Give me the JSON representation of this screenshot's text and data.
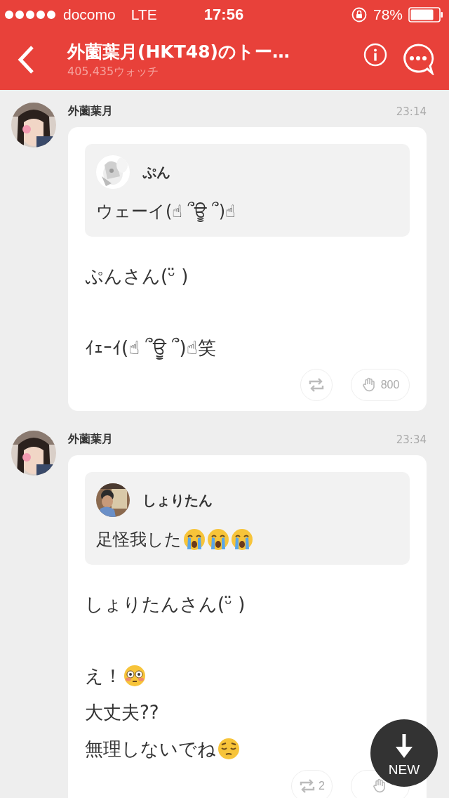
{
  "status_bar": {
    "carrier": "docomo",
    "network": "LTE",
    "time": "17:56",
    "battery": "78%"
  },
  "header": {
    "title": "外薗葉月(HKT48)のトー…",
    "subtitle": "405,435ウォッチ"
  },
  "messages": [
    {
      "author": "外薗葉月",
      "time": "23:14",
      "quote": {
        "author": "ぷん",
        "lines": [
          [
            {
              "kind": "text",
              "text": "ウェーイ(☝ ՞ਊ ՞)☝"
            }
          ]
        ]
      },
      "lines": [
        {
          "kind": "text",
          "parts": [
            {
              "kind": "text",
              "text": "ぷんさん(ᵕ̈ )"
            }
          ]
        },
        {
          "kind": "gap"
        },
        {
          "kind": "text",
          "parts": [
            {
              "kind": "text",
              "text": "ｲｪｰｲ(☝ ՞ਊ ՞)☝笑"
            }
          ]
        }
      ],
      "like_count": "800"
    },
    {
      "author": "外薗葉月",
      "time": "23:34",
      "quote": {
        "author": "しょりたん",
        "lines": [
          [
            {
              "kind": "text",
              "text": "足怪我した"
            },
            {
              "kind": "crying"
            },
            {
              "kind": "crying"
            },
            {
              "kind": "crying"
            }
          ]
        ]
      },
      "lines": [
        {
          "kind": "text",
          "parts": [
            {
              "kind": "text",
              "text": "しょりたんさん(ᵕ̈ )"
            }
          ]
        },
        {
          "kind": "gap"
        },
        {
          "kind": "text",
          "parts": [
            {
              "kind": "text",
              "text": "え！"
            },
            {
              "kind": "flushed"
            }
          ]
        },
        {
          "kind": "text",
          "parts": [
            {
              "kind": "text",
              "text": "大丈夫??"
            }
          ]
        },
        {
          "kind": "text",
          "parts": [
            {
              "kind": "text",
              "text": "無理しないでね"
            },
            {
              "kind": "pensive"
            }
          ]
        }
      ],
      "repost_count": "2"
    }
  ],
  "new_button": {
    "label": "NEW"
  }
}
